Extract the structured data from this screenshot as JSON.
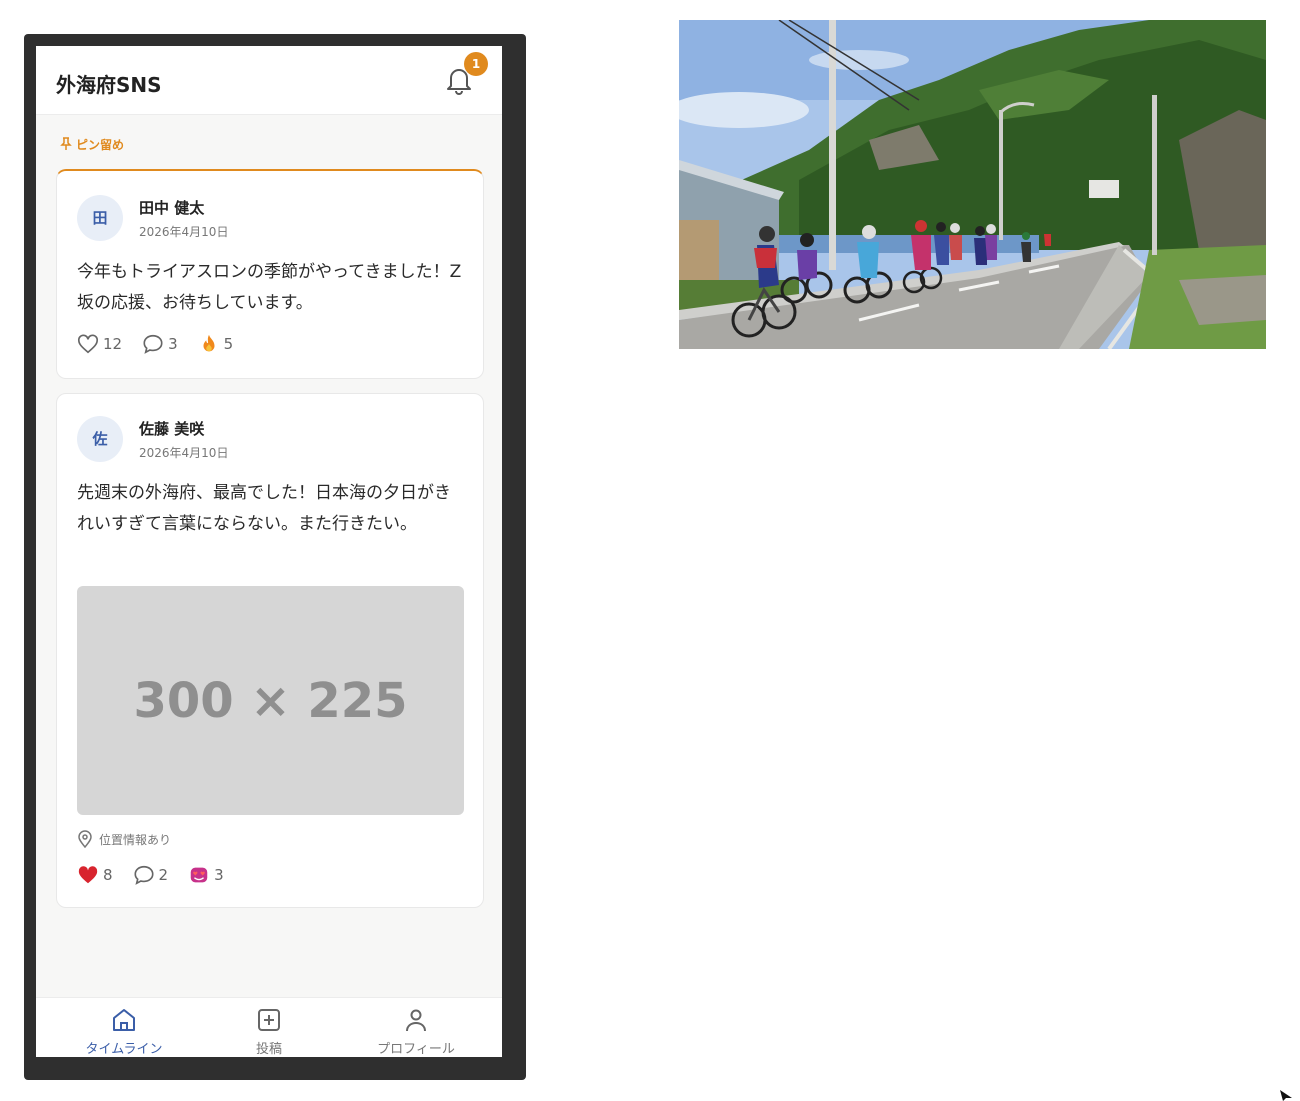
{
  "app": {
    "title": "外海府SNS",
    "notification_count": "1"
  },
  "pinned": {
    "label": "ピン留め"
  },
  "posts": [
    {
      "avatar_initial": "田",
      "author": "田中 健太",
      "date": "2026年4月10日",
      "text": "今年もトライアスロンの季節がやってきました！Z坂の応援、お待ちしています。",
      "likes": "12",
      "comments": "3",
      "reaction_count": "5",
      "reaction_icon": "fire-icon",
      "liked": false
    },
    {
      "avatar_initial": "佐",
      "author": "佐藤 美咲",
      "date": "2026年4月10日",
      "text": "先週末の外海府、最高でした！日本海の夕日がきれいすぎて言葉にならない。また行きたい。",
      "image_placeholder": "300 × 225",
      "location": "位置情報あり",
      "likes": "8",
      "comments": "2",
      "reaction_count": "3",
      "reaction_icon": "heart-eyes-icon",
      "liked": true
    }
  ],
  "nav": {
    "timeline": "タイムライン",
    "post": "投稿",
    "profile": "プロフィール",
    "active": "timeline"
  },
  "colors": {
    "accent": "#e08a1e",
    "primary": "#3b5ea8",
    "like": "#d8242e"
  }
}
